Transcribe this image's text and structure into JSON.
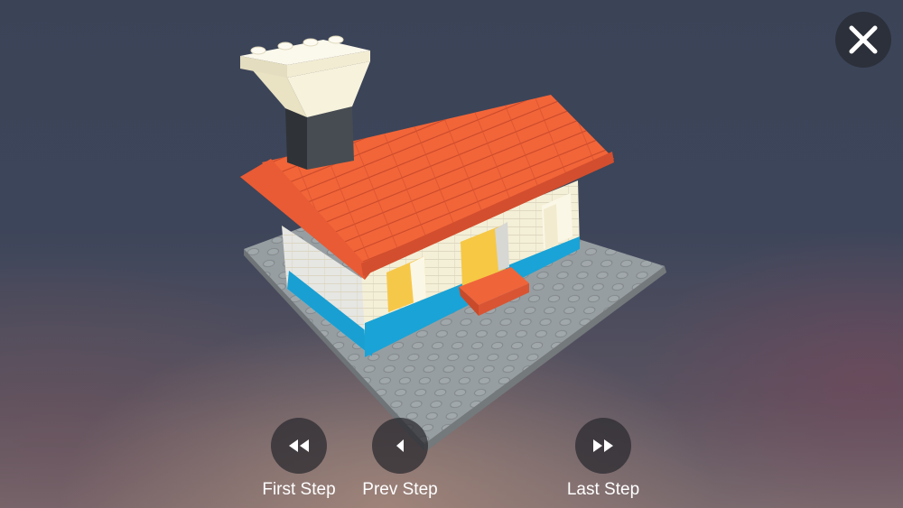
{
  "controls": {
    "close": {
      "icon": "close-icon"
    },
    "first_step": {
      "label": "First Step",
      "icon": "fast-rewind-icon"
    },
    "prev_step": {
      "label": "Prev Step",
      "icon": "triangle-left-icon"
    },
    "last_step": {
      "label": "Last Step",
      "icon": "fast-forward-icon"
    }
  },
  "colors": {
    "baseplate": "#8f9699",
    "roof": "#f0643a",
    "walls": "#f4efd7",
    "trim": "#1aa0d4",
    "window": "#f5c540",
    "chimney_dark": "#3c4045",
    "chimney_top": "#f8f3dc"
  }
}
